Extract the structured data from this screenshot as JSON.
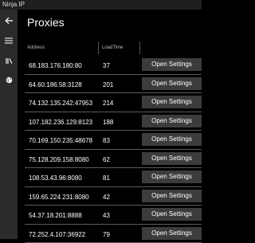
{
  "window": {
    "title": "Ninja IP"
  },
  "header": {
    "title": "Proxies"
  },
  "nav": [
    {
      "icon": "back-arrow-icon"
    },
    {
      "icon": "hamburger-menu-icon"
    },
    {
      "icon": "library-icon"
    },
    {
      "icon": "globe-icon"
    }
  ],
  "table": {
    "columns": [
      "Address",
      "LoadTime"
    ],
    "action_label": "Open Settings",
    "rows": [
      {
        "address": "68.183.176.180:80",
        "loadtime": "37"
      },
      {
        "address": "64.60.186.58:3128",
        "loadtime": "201"
      },
      {
        "address": "74.132.135.242:47953",
        "loadtime": "214"
      },
      {
        "address": "107.182.236.129:8123",
        "loadtime": "188"
      },
      {
        "address": "70.169.150.235:48678",
        "loadtime": "83"
      },
      {
        "address": "75.128.209.158:8080",
        "loadtime": "62"
      },
      {
        "address": "108.53.43.96:8080",
        "loadtime": "81"
      },
      {
        "address": "159.65.224.231:8080",
        "loadtime": "42"
      },
      {
        "address": "54.37.18.201:8888",
        "loadtime": "43"
      },
      {
        "address": "72.252.4.107:36922",
        "loadtime": "79"
      }
    ]
  }
}
